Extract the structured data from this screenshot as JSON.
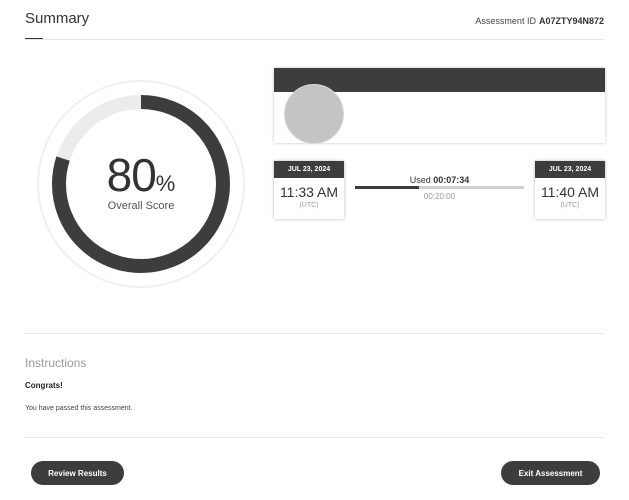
{
  "header": {
    "title": "Summary",
    "assessment_id_label": "Assessment ID",
    "assessment_id_value": "A07ZTY94N872"
  },
  "score": {
    "value": "80",
    "unit": "%",
    "label": "Overall Score",
    "fraction": 0.8
  },
  "timing": {
    "start": {
      "date": "JUL 23, 2024",
      "time": "11:33 AM",
      "timezone": "(UTC)"
    },
    "end": {
      "date": "JUL 23, 2024",
      "time": "11:40 AM",
      "timezone": "(UTC)"
    },
    "used_label": "Used",
    "used_value": "00:07:34",
    "limit_value": "00:20:00",
    "used_fraction": 0.378
  },
  "instructions": {
    "title": "Instructions",
    "heading": "Congrats!",
    "body": "You have passed this assessment."
  },
  "buttons": {
    "review": "Review Results",
    "exit": "Exit Assessment"
  },
  "colors": {
    "dark": "#3d3d3d",
    "ring_track": "#ececec",
    "avatar": "#c4c4c4"
  }
}
